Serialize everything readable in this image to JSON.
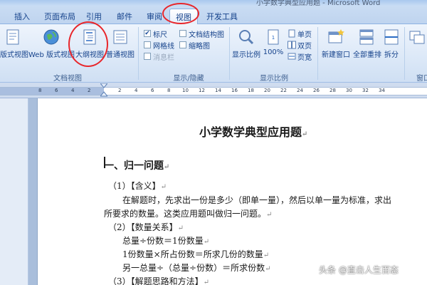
{
  "window": {
    "title": "小学数学典型应用题 - Microsoft Word"
  },
  "tabs": [
    "插入",
    "页面布局",
    "引用",
    "邮件",
    "审阅",
    "视图",
    "开发工具"
  ],
  "ribbon": {
    "doc_views": {
      "label": "文档视图",
      "buttons": [
        "版式视图",
        "Web 版式视图",
        "大纲视图",
        "普通视图"
      ]
    },
    "show_hide": {
      "label": "显示/隐藏",
      "checkboxes": [
        {
          "label": "标尺",
          "checked": true
        },
        {
          "label": "网格线",
          "checked": false
        },
        {
          "label": "消息栏",
          "checked": false
        },
        {
          "label": "文档结构图",
          "checked": false
        },
        {
          "label": "缩略图",
          "checked": false
        }
      ]
    },
    "zoom": {
      "label": "显示比例",
      "zoom_button": "显示比例",
      "percent_button": "100%",
      "single_page": "单页",
      "two_pages": "双页",
      "page_width": "页宽"
    },
    "window_group": {
      "label": "窗口",
      "new_window": "新建窗口",
      "arrange_all": "全部重排",
      "split": "拆分"
    }
  },
  "ruler": {
    "numbers": [
      "8",
      "6",
      "4",
      "2",
      "2",
      "4",
      "6",
      "8",
      "10",
      "12",
      "14",
      "16",
      "18",
      "20",
      "22",
      "24",
      "26",
      "28",
      "30",
      "32",
      "34"
    ]
  },
  "document": {
    "title": "小学数学典型应用题",
    "heading": "一、归一问题",
    "lines": [
      "（1）【含义】",
      "在解题时，先求出一份是多少（即单一量），然后以单一量为标准，求出",
      "所要求的数量。这类应用题叫做归一问题。",
      "（2）【数量关系】",
      "总量÷份数＝1份数量",
      "1份数量×所占份数＝所求几份的数量",
      "另一总量÷（总量÷份数）＝所求份数",
      "（3）【解题思路和方法】"
    ],
    "para_mark": "↵"
  },
  "watermark": "头条 @直击人生百态",
  "colors": {
    "accent_ring": "#e8262b",
    "ribbon_bg": "#dde9f8",
    "tab_text": "#15428b"
  }
}
